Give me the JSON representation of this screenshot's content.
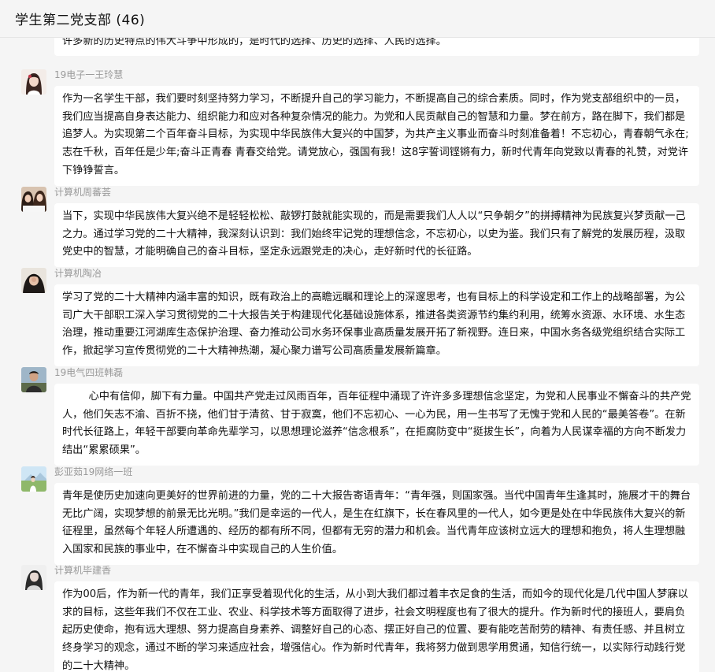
{
  "header": {
    "title": "学生第二党支部 (46)"
  },
  "messages": [
    {
      "sender": "",
      "text": "许多新的历史特点的伟大斗争中形成的，是时代的选择、历史的选择、人民的选择。"
    },
    {
      "sender": "19电子一王玲慧",
      "text": "作为一名学生干部，我们要时刻坚持努力学习，不断提升自己的学习能力，不断提高自己的综合素质。同时，作为党支部组织中的一员，我们应当提高自身表达能力、组织能力和应对各种复杂情况的能力。为党和人民贡献自己的智慧和力量。梦在前方，路在脚下，我们都是追梦人。为实现第二个百年奋斗目标，为实现中华民族伟大复兴的中国梦，为共产主义事业而奋斗时刻准备着！不忘初心，青春朝气永在;志在千秋，百年任是少年;奋斗正青春 青春交给党。请党放心，强国有我！这8字誓词铿锵有力，新时代青年向党致以青春的礼赞，对党许下铮铮誓言。"
    },
    {
      "sender": "计算机周蕃荟",
      "text": "当下，实现中华民族伟大复兴绝不是轻轻松松、敲锣打鼓就能实现的，而是需要我们人人以“只争朝夕”的拼搏精神为民族复兴梦贡献一己之力。通过学习党的二十大精神，我深刻认识到：我们始终牢记党的理想信念，不忘初心，以史为鉴。我们只有了解党的发展历程，汲取党史中的智慧，才能明确自己的奋斗目标，坚定永远跟党走的决心，走好新时代的长征路。"
    },
    {
      "sender": "计算机陶冶",
      "text": "学习了党的二十大精神内涵丰富的知识，既有政治上的高瞻远瞩和理论上的深邃思考，也有目标上的科学设定和工作上的战略部署，为公司广大干部职工深入学习贯彻党的二十大报告关于构建现代化基础设施体系，推进各类资源节约集约利用，统筹水资源、水环境、水生态治理，推动重要江河湖库生态保护治理、奋力推动公司水务环保事业高质量发展开拓了新视野。连日来，中国水务各级党组织结合实际工作，掀起学习宣传贯彻党的二十大精神热潮，凝心聚力谱写公司高质量发展新篇章。"
    },
    {
      "sender": "19电气四班韩磊",
      "text": "        心中有信仰，脚下有力量。中国共产党走过风雨百年，百年征程中涌现了许许多多理想信念坚定，为党和人民事业不懈奋斗的共产党人，他们矢志不渝、百折不挠，他们甘于清贫、甘于寂寞，他们不忘初心、一心为民，用一生书写了无愧于党和人民的“最美答卷”。在新时代长征路上，年轻干部要向革命先辈学习，以思想理论滋养“信念根系”，在拒腐防变中“挺拔生长”，向着为人民谋幸福的方向不断发力结出“累累硕果”。"
    },
    {
      "sender": "彭亚茹19网络一班",
      "text": "青年是使历史加速向更美好的世界前进的力量，党的二十大报告寄语青年：“青年强，则国家强。当代中国青年生逢其时，施展才干的舞台无比广阔，实现梦想的前景无比光明。”我们是幸运的一代人，是生在红旗下，长在春风里的一代人，如今更是处在中华民族伟大复兴的新征程里，虽然每个年轻人所遭遇的、经历的都有所不同，但都有无穷的潜力和机会。当代青年应该树立远大的理想和抱负，将人生理想融入国家和民族的事业中，在不懈奋斗中实现自己的人生价值。"
    },
    {
      "sender": "计算机毕建香",
      "text": "作为00后，作为新一代的青年，我们正享受着现代化的生活，从小到大我们都过着丰衣足食的生活，而如今的现代化是几代中国人梦寐以求的目标，这些年我们不仅在工业、农业、科学技术等方面取得了进步，社会文明程度也有了很大的提升。作为新时代的接班人，要肩负起历史使命，抱有远大理想、努力提高自身素养、调整好自己的心态、摆正好自己的位置、要有能吃苦耐劳的精神、有责任感、并且树立终身学习的观念，通过不断的学习来适应社会，增强信心。作为新时代青年，我将努力做到思学用贯通，知信行统一，以实际行动践行党的二十大精神。"
    }
  ],
  "colors": {
    "background": "#f5f5f5",
    "bubble": "#ffffff",
    "sender": "#9a9a9a"
  }
}
